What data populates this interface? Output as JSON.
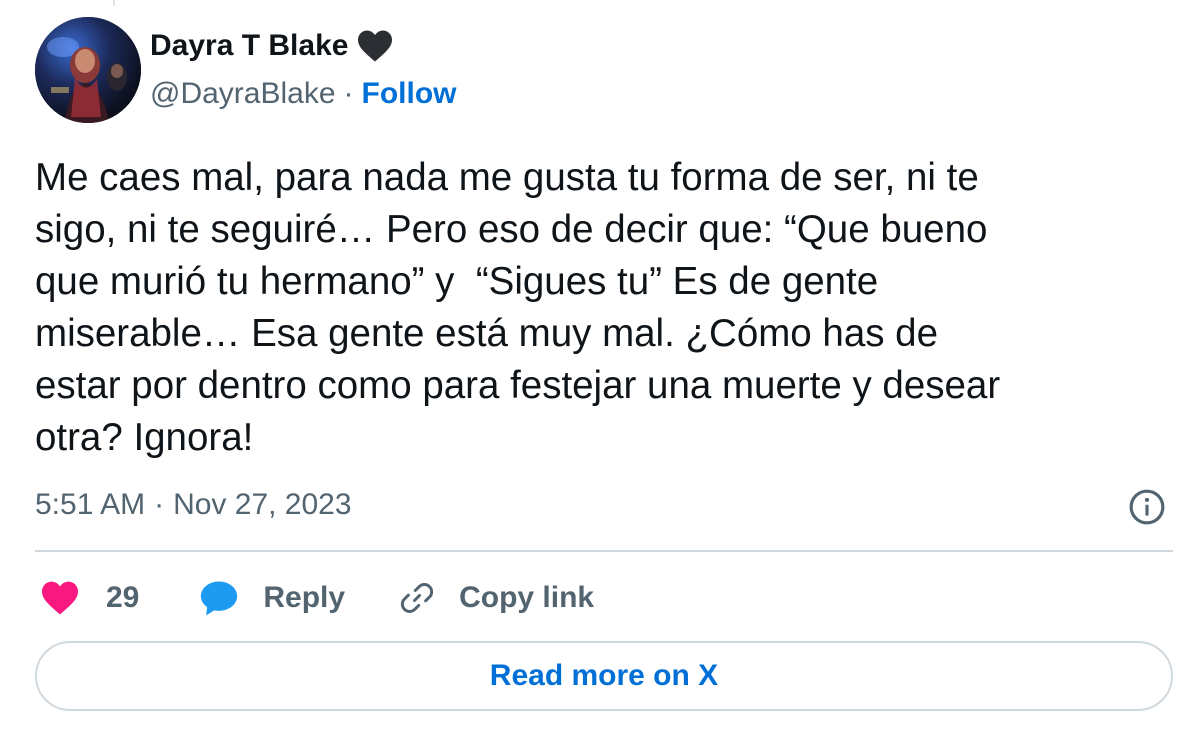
{
  "author": {
    "display_name": "Dayra T Blake",
    "name_badge_icon": "black-heart-icon",
    "handle": "@DayraBlake",
    "separator": "·",
    "follow_label": "Follow"
  },
  "tweet": {
    "text": "Me caes mal, para nada me gusta tu forma de ser, ni te\nsigo, ni te seguiré… Pero eso de decir que: “Que bueno\nque murió tu hermano” y  “Sigues tu” Es de gente\nmiserable… Esa gente está muy mal. ¿Cómo has de\nestar por dentro como para festejar una muerte y desear\notra? Ignora!",
    "time": "5:51 AM",
    "separator": "·",
    "date": "Nov 27, 2023"
  },
  "actions": {
    "like_icon": "heart-icon",
    "like_count": "29",
    "reply_icon": "speech-bubble-icon",
    "reply_label": "Reply",
    "copy_icon": "link-icon",
    "copy_label": "Copy link"
  },
  "footer": {
    "read_more_label": "Read more on X"
  },
  "colors": {
    "accent": "#006fd6",
    "like": "#f91880",
    "reply": "#1d9bf0",
    "secondary_text": "#536471",
    "border": "#cfd9de"
  }
}
